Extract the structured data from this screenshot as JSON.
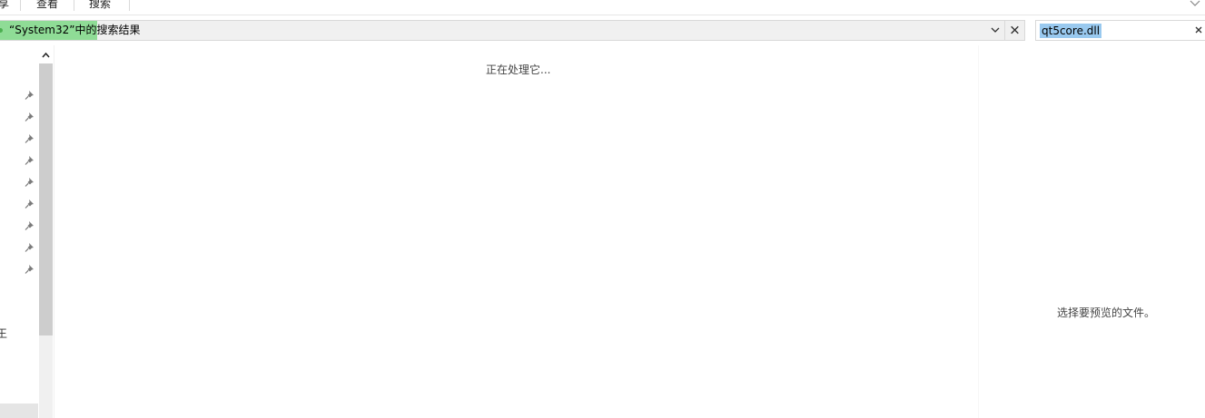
{
  "ribbon": {
    "tabs": [
      "享",
      "查看",
      "搜索"
    ]
  },
  "address_bar": {
    "path": "“System32”中的搜索结果",
    "progress_color": "#8fdc96"
  },
  "search": {
    "value": "qt5core.dll"
  },
  "nav_pane": {
    "pinned_count": 9,
    "edge_glyph": "王"
  },
  "content": {
    "status": "正在处理它..."
  },
  "preview": {
    "message": "选择要预览的文件。"
  }
}
